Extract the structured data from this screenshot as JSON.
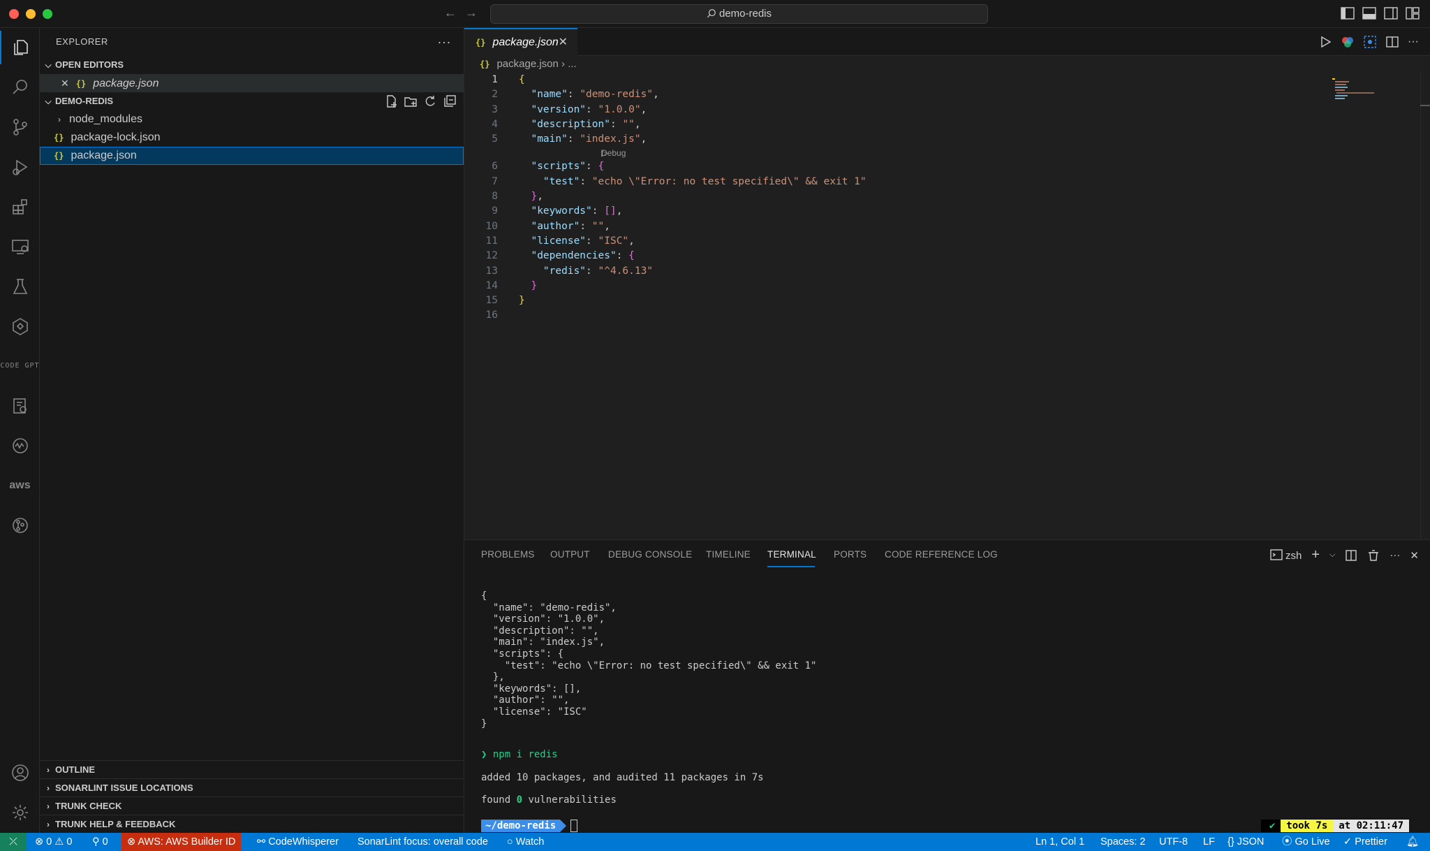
{
  "titlebar": {
    "search_text": "demo-redis"
  },
  "activity_bar": {
    "items": [
      "explorer",
      "search",
      "source-control",
      "run-debug",
      "extensions",
      "remote-explorer",
      "testing",
      "hex",
      "codegpt",
      "settings-gear",
      "timeline",
      "aws",
      "git-graph"
    ],
    "codegpt_text": "CODE GPT",
    "aws_text": "aws"
  },
  "sidebar": {
    "title": "EXPLORER",
    "more": "···",
    "open_editors": {
      "label": "OPEN EDITORS",
      "items": [
        {
          "icon": "{}",
          "name": "package.json"
        }
      ]
    },
    "folder": {
      "label": "DEMO-REDIS",
      "items": [
        {
          "type": "folder",
          "name": "node_modules"
        },
        {
          "type": "json",
          "icon": "{}",
          "name": "package-lock.json"
        },
        {
          "type": "json",
          "icon": "{}",
          "name": "package.json"
        }
      ]
    },
    "bottom_sections": [
      "OUTLINE",
      "SONARLINT ISSUE LOCATIONS",
      "TRUNK CHECK",
      "TRUNK HELP & FEEDBACK"
    ]
  },
  "editor": {
    "tab": {
      "icon": "{}",
      "label": "package.json"
    },
    "breadcrumb": {
      "file": "package.json",
      "rest": "..."
    },
    "codelens": "Debug",
    "line_numbers": [
      "1",
      "2",
      "3",
      "4",
      "5",
      "6",
      "7",
      "8",
      "9",
      "10",
      "11",
      "12",
      "13",
      "14",
      "15",
      "16"
    ]
  },
  "panel": {
    "tabs": [
      "PROBLEMS",
      "OUTPUT",
      "DEBUG CONSOLE",
      "TIMELINE",
      "TERMINAL",
      "PORTS",
      "CODE REFERENCE LOG"
    ],
    "active_tab": "TERMINAL",
    "shell": "zsh",
    "terminal_lines": [
      "{",
      "  \"name\": \"demo-redis\",",
      "  \"version\": \"1.0.0\",",
      "  \"description\": \"\",",
      "  \"main\": \"index.js\",",
      "  \"scripts\": {",
      "    \"test\": \"echo \\\"Error: no test specified\\\" && exit 1\"",
      "  },",
      "  \"keywords\": [],",
      "  \"author\": \"\",",
      "  \"license\": \"ISC\"",
      "}"
    ],
    "command_prompt": "❯",
    "command": "npm i redis",
    "output_added": "added 10 packages, and audited 11 packages in 7s",
    "output_found_prefix": "found ",
    "output_found_count": "0",
    "output_found_suffix": " vulnerabilities",
    "prompt_dir": "~/demo-redis",
    "rprompt_ok": "✔",
    "rprompt_took": "took 7s",
    "rprompt_time": "at 02:11:47"
  },
  "statusbar": {
    "errors": "0",
    "warnings": "0",
    "ports": "0",
    "aws": "AWS: AWS Builder ID",
    "codewhisperer": "CodeWhisperer",
    "sonarlint": "SonarLint focus: overall code",
    "watch": "Watch",
    "position": "Ln 1, Col 1",
    "spaces": "Spaces: 2",
    "encoding": "UTF-8",
    "eol": "LF",
    "language": "JSON",
    "golive": "Go Live",
    "prettier": "Prettier"
  },
  "colors": {
    "accent": "#0078d4",
    "status_bar": "#0078d4",
    "remote": "#16825d",
    "aws_badge": "#c72e0f",
    "json_icon": "#cbcb41"
  }
}
